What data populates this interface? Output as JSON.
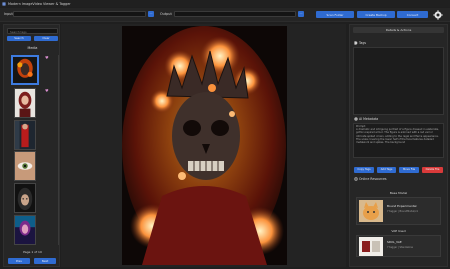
{
  "window": {
    "title": "Modern ImageVideo Viewer & Tagger"
  },
  "toolbar": {
    "input_label": "Input",
    "output_label": "Output",
    "browse_label": "…",
    "scan_folder": "Scan Folder",
    "create_backup": "Create Backup",
    "convert": "Convert",
    "settings_icon": "gear-icon"
  },
  "left_panel": {
    "search_placeholder": "Search tags",
    "search_button": "Search",
    "clear_button": "Clear",
    "media_header": "Media",
    "page_label": "Page 1 of 10",
    "prev_button": "Prev",
    "next_button": "Next"
  },
  "right_panel": {
    "details_tab": "Details & Actions",
    "tags_title": "Tags",
    "metadata_title": "AI Metadata",
    "metadata_label": "Prompt:",
    "metadata_text": "A dramatic and intriguing portrait of a figure dressed in elaborate, gothic-inspired armor. The figure is adorned with a red veil or intricate spiked crown, adding to the regal and fierce appearance. The scale covering the lower half of the face features detailed metalwork and spikes. The background",
    "copy_tags": "Copy Tags",
    "add_tags": "Add Tags",
    "move_file": "Move File",
    "delete_file": "Delete File",
    "online_resources": "Online Resources",
    "base_model_header": "Base Model",
    "base_model_name": "Bound Experimental",
    "base_model_sub": "7 tagger | BoundModel/v1",
    "vae_header": "VAE Used",
    "vae_name": "SDXL_VAE",
    "vae_sub": "7 tagger | Standalone"
  },
  "colors": {
    "accent": "#2f6bd1",
    "danger": "#d93a3a",
    "background": "#1f1f1f"
  }
}
